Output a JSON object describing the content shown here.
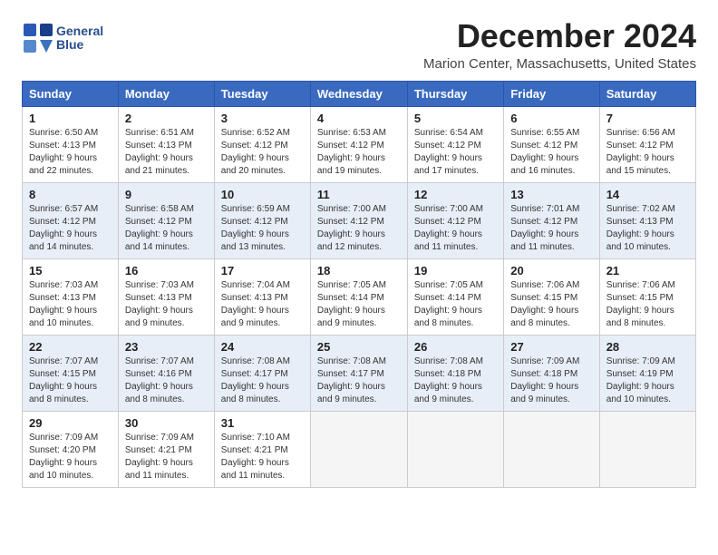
{
  "header": {
    "logo_line1": "General",
    "logo_line2": "Blue",
    "month": "December 2024",
    "location": "Marion Center, Massachusetts, United States"
  },
  "weekdays": [
    "Sunday",
    "Monday",
    "Tuesday",
    "Wednesday",
    "Thursday",
    "Friday",
    "Saturday"
  ],
  "weeks": [
    [
      {
        "day": "1",
        "sunrise": "6:50 AM",
        "sunset": "4:13 PM",
        "daylight": "9 hours and 22 minutes."
      },
      {
        "day": "2",
        "sunrise": "6:51 AM",
        "sunset": "4:13 PM",
        "daylight": "9 hours and 21 minutes."
      },
      {
        "day": "3",
        "sunrise": "6:52 AM",
        "sunset": "4:12 PM",
        "daylight": "9 hours and 20 minutes."
      },
      {
        "day": "4",
        "sunrise": "6:53 AM",
        "sunset": "4:12 PM",
        "daylight": "9 hours and 19 minutes."
      },
      {
        "day": "5",
        "sunrise": "6:54 AM",
        "sunset": "4:12 PM",
        "daylight": "9 hours and 17 minutes."
      },
      {
        "day": "6",
        "sunrise": "6:55 AM",
        "sunset": "4:12 PM",
        "daylight": "9 hours and 16 minutes."
      },
      {
        "day": "7",
        "sunrise": "6:56 AM",
        "sunset": "4:12 PM",
        "daylight": "9 hours and 15 minutes."
      }
    ],
    [
      {
        "day": "8",
        "sunrise": "6:57 AM",
        "sunset": "4:12 PM",
        "daylight": "9 hours and 14 minutes."
      },
      {
        "day": "9",
        "sunrise": "6:58 AM",
        "sunset": "4:12 PM",
        "daylight": "9 hours and 14 minutes."
      },
      {
        "day": "10",
        "sunrise": "6:59 AM",
        "sunset": "4:12 PM",
        "daylight": "9 hours and 13 minutes."
      },
      {
        "day": "11",
        "sunrise": "7:00 AM",
        "sunset": "4:12 PM",
        "daylight": "9 hours and 12 minutes."
      },
      {
        "day": "12",
        "sunrise": "7:00 AM",
        "sunset": "4:12 PM",
        "daylight": "9 hours and 11 minutes."
      },
      {
        "day": "13",
        "sunrise": "7:01 AM",
        "sunset": "4:12 PM",
        "daylight": "9 hours and 11 minutes."
      },
      {
        "day": "14",
        "sunrise": "7:02 AM",
        "sunset": "4:13 PM",
        "daylight": "9 hours and 10 minutes."
      }
    ],
    [
      {
        "day": "15",
        "sunrise": "7:03 AM",
        "sunset": "4:13 PM",
        "daylight": "9 hours and 10 minutes."
      },
      {
        "day": "16",
        "sunrise": "7:03 AM",
        "sunset": "4:13 PM",
        "daylight": "9 hours and 9 minutes."
      },
      {
        "day": "17",
        "sunrise": "7:04 AM",
        "sunset": "4:13 PM",
        "daylight": "9 hours and 9 minutes."
      },
      {
        "day": "18",
        "sunrise": "7:05 AM",
        "sunset": "4:14 PM",
        "daylight": "9 hours and 9 minutes."
      },
      {
        "day": "19",
        "sunrise": "7:05 AM",
        "sunset": "4:14 PM",
        "daylight": "9 hours and 8 minutes."
      },
      {
        "day": "20",
        "sunrise": "7:06 AM",
        "sunset": "4:15 PM",
        "daylight": "9 hours and 8 minutes."
      },
      {
        "day": "21",
        "sunrise": "7:06 AM",
        "sunset": "4:15 PM",
        "daylight": "9 hours and 8 minutes."
      }
    ],
    [
      {
        "day": "22",
        "sunrise": "7:07 AM",
        "sunset": "4:15 PM",
        "daylight": "9 hours and 8 minutes."
      },
      {
        "day": "23",
        "sunrise": "7:07 AM",
        "sunset": "4:16 PM",
        "daylight": "9 hours and 8 minutes."
      },
      {
        "day": "24",
        "sunrise": "7:08 AM",
        "sunset": "4:17 PM",
        "daylight": "9 hours and 8 minutes."
      },
      {
        "day": "25",
        "sunrise": "7:08 AM",
        "sunset": "4:17 PM",
        "daylight": "9 hours and 9 minutes."
      },
      {
        "day": "26",
        "sunrise": "7:08 AM",
        "sunset": "4:18 PM",
        "daylight": "9 hours and 9 minutes."
      },
      {
        "day": "27",
        "sunrise": "7:09 AM",
        "sunset": "4:18 PM",
        "daylight": "9 hours and 9 minutes."
      },
      {
        "day": "28",
        "sunrise": "7:09 AM",
        "sunset": "4:19 PM",
        "daylight": "9 hours and 10 minutes."
      }
    ],
    [
      {
        "day": "29",
        "sunrise": "7:09 AM",
        "sunset": "4:20 PM",
        "daylight": "9 hours and 10 minutes."
      },
      {
        "day": "30",
        "sunrise": "7:09 AM",
        "sunset": "4:21 PM",
        "daylight": "9 hours and 11 minutes."
      },
      {
        "day": "31",
        "sunrise": "7:10 AM",
        "sunset": "4:21 PM",
        "daylight": "9 hours and 11 minutes."
      },
      null,
      null,
      null,
      null
    ]
  ]
}
